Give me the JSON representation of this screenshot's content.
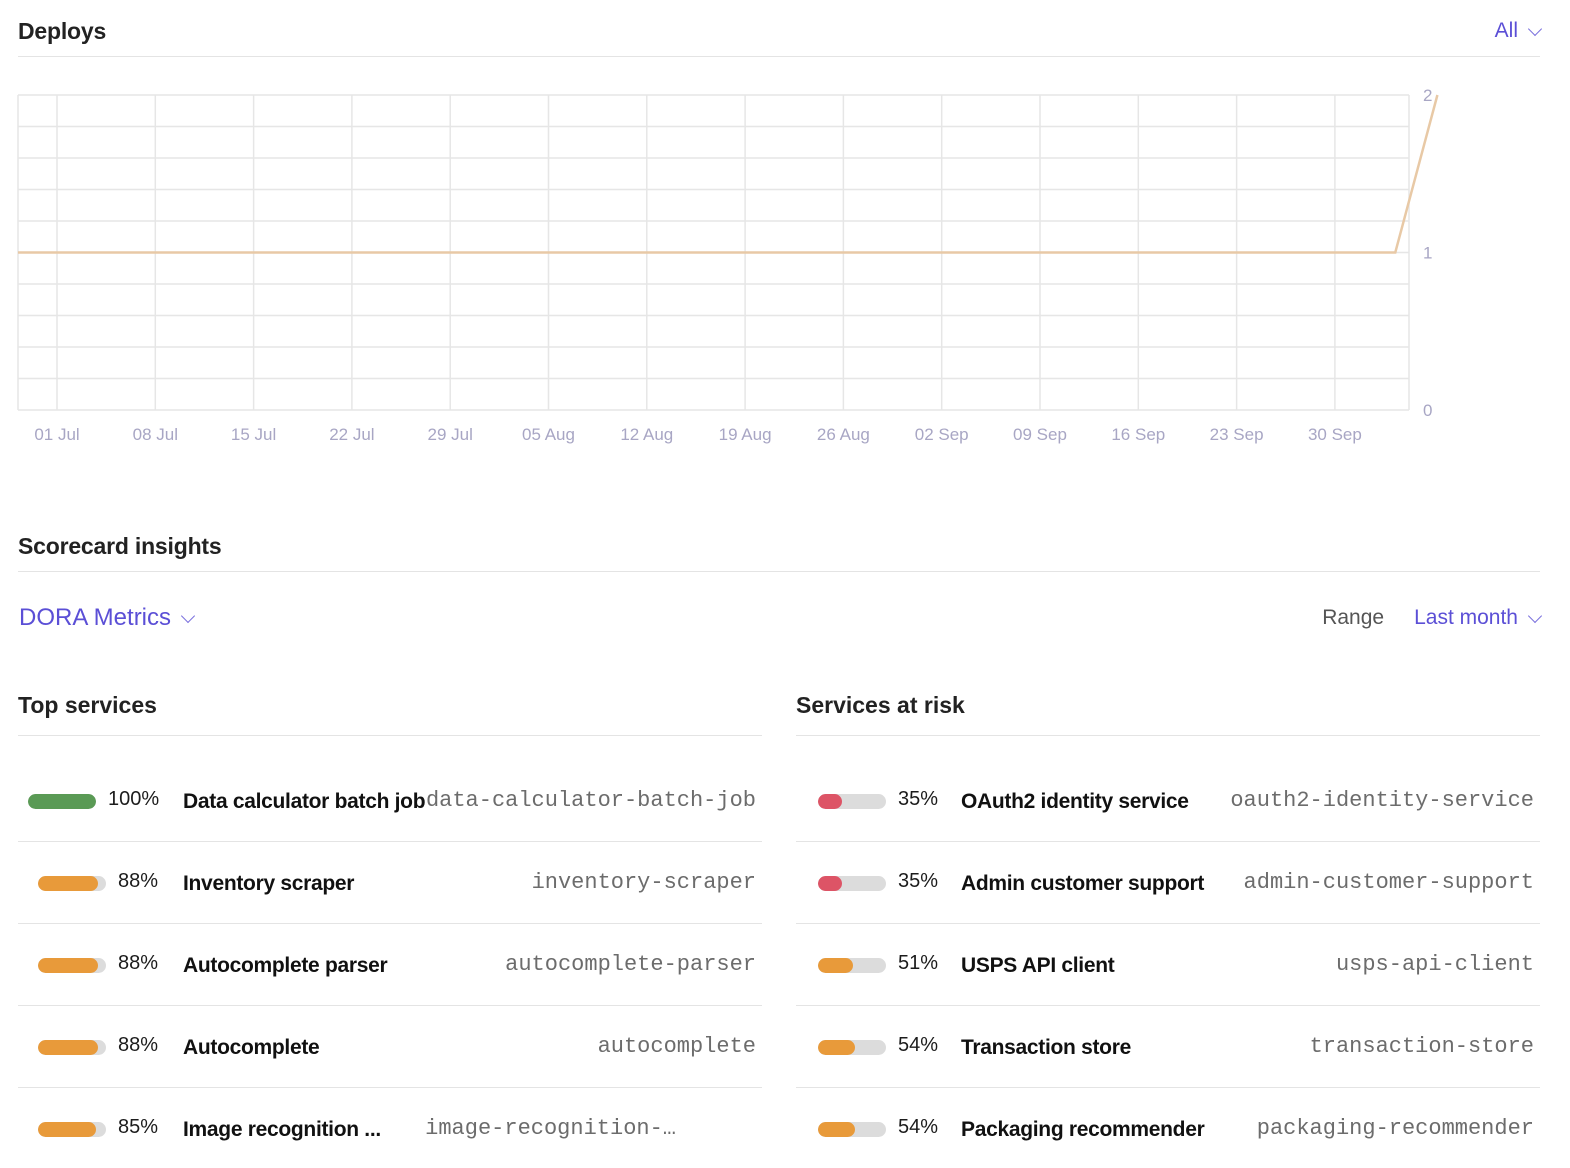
{
  "deploys": {
    "title": "Deploys",
    "filter_label": "All"
  },
  "chart_data": {
    "type": "line",
    "x": [
      "01 Jul",
      "08 Jul",
      "15 Jul",
      "22 Jul",
      "29 Jul",
      "05 Aug",
      "12 Aug",
      "19 Aug",
      "26 Aug",
      "02 Sep",
      "09 Sep",
      "16 Sep",
      "23 Sep",
      "30 Sep"
    ],
    "series": [
      {
        "values": [
          1,
          1,
          1,
          1,
          1,
          1,
          1,
          1,
          1,
          1,
          1,
          1,
          1,
          1
        ],
        "tail": [
          {
            "after_days": 4.3,
            "value": 1
          },
          {
            "after_days": 7.3,
            "value": 2
          }
        ]
      }
    ],
    "y_ticks": [
      "0",
      "1",
      "2"
    ],
    "ylim": [
      0,
      2
    ],
    "grid": true,
    "line_color": "#e8c9a6"
  },
  "scorecard": {
    "title": "Scorecard insights",
    "metric_selector": "DORA Metrics",
    "range_label": "Range",
    "range_value": "Last month"
  },
  "top_services": {
    "title": "Top services",
    "rows": [
      {
        "percent": "100%",
        "fraction": 1.0,
        "color": "#5a9a55",
        "name": "Data calculator batch job",
        "id": "data-calculator-batch-job"
      },
      {
        "percent": "88%",
        "fraction": 0.88,
        "color": "#e89a3a",
        "name": "Inventory scraper",
        "id": "inventory-scraper"
      },
      {
        "percent": "88%",
        "fraction": 0.88,
        "color": "#e89a3a",
        "name": "Autocomplete parser",
        "id": "autocomplete-parser"
      },
      {
        "percent": "88%",
        "fraction": 0.88,
        "color": "#e89a3a",
        "name": "Autocomplete",
        "id": "autocomplete"
      },
      {
        "percent": "85%",
        "fraction": 0.85,
        "color": "#e89a3a",
        "name": "Image recognition ...",
        "id": "image-recognition-…"
      }
    ]
  },
  "services_at_risk": {
    "title": "Services at risk",
    "rows": [
      {
        "percent": "35%",
        "fraction": 0.35,
        "color": "#dd5466",
        "name": "OAuth2 identity service",
        "id": "oauth2-identity-service"
      },
      {
        "percent": "35%",
        "fraction": 0.35,
        "color": "#dd5466",
        "name": "Admin customer support",
        "id": "admin-customer-support"
      },
      {
        "percent": "51%",
        "fraction": 0.51,
        "color": "#e89a3a",
        "name": "USPS API client",
        "id": "usps-api-client"
      },
      {
        "percent": "54%",
        "fraction": 0.54,
        "color": "#e89a3a",
        "name": "Transaction store",
        "id": "transaction-store"
      },
      {
        "percent": "54%",
        "fraction": 0.54,
        "color": "#e89a3a",
        "name": "Packaging recommender",
        "id": "packaging-recommender"
      }
    ]
  }
}
